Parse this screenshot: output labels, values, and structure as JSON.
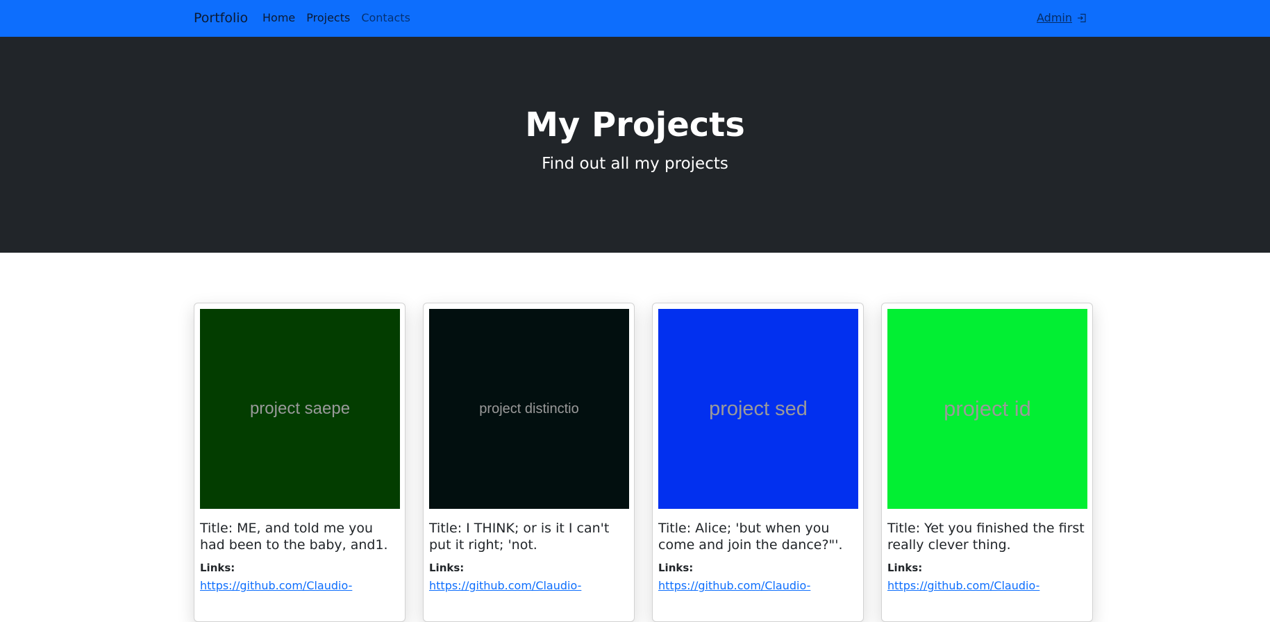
{
  "navbar": {
    "brand": "Portfolio",
    "links": [
      {
        "label": "Home"
      },
      {
        "label": "Projects"
      },
      {
        "label": "Contacts"
      }
    ],
    "admin_label": "Admin",
    "admin_icon": "login-icon",
    "background": "#0d6efd"
  },
  "hero": {
    "title": "My Projects",
    "subtitle": "Find out all my projects",
    "background": "#212529"
  },
  "projects": [
    {
      "image_text": "project saepe",
      "image_bg": "#033d00",
      "title": "Title: ME, and told me you had been to the baby, and1.",
      "links_label": "Links:",
      "link": "https://github.com/Claudio-"
    },
    {
      "image_text": "project distinctio",
      "image_bg": "#020f0f",
      "title": "Title: I THINK; or is it I can't put it right; 'not.",
      "links_label": "Links:",
      "link": "https://github.com/Claudio-"
    },
    {
      "image_text": "project sed",
      "image_bg": "#0230ef",
      "title": "Title: Alice; 'but when you come and join the dance?\"'.",
      "links_label": "Links:",
      "link": "https://github.com/Claudio-"
    },
    {
      "image_text": "project id",
      "image_bg": "#02ef33",
      "title": "Title: Yet you finished the first really clever thing.",
      "links_label": "Links:",
      "link": "https://github.com/Claudio-"
    }
  ]
}
